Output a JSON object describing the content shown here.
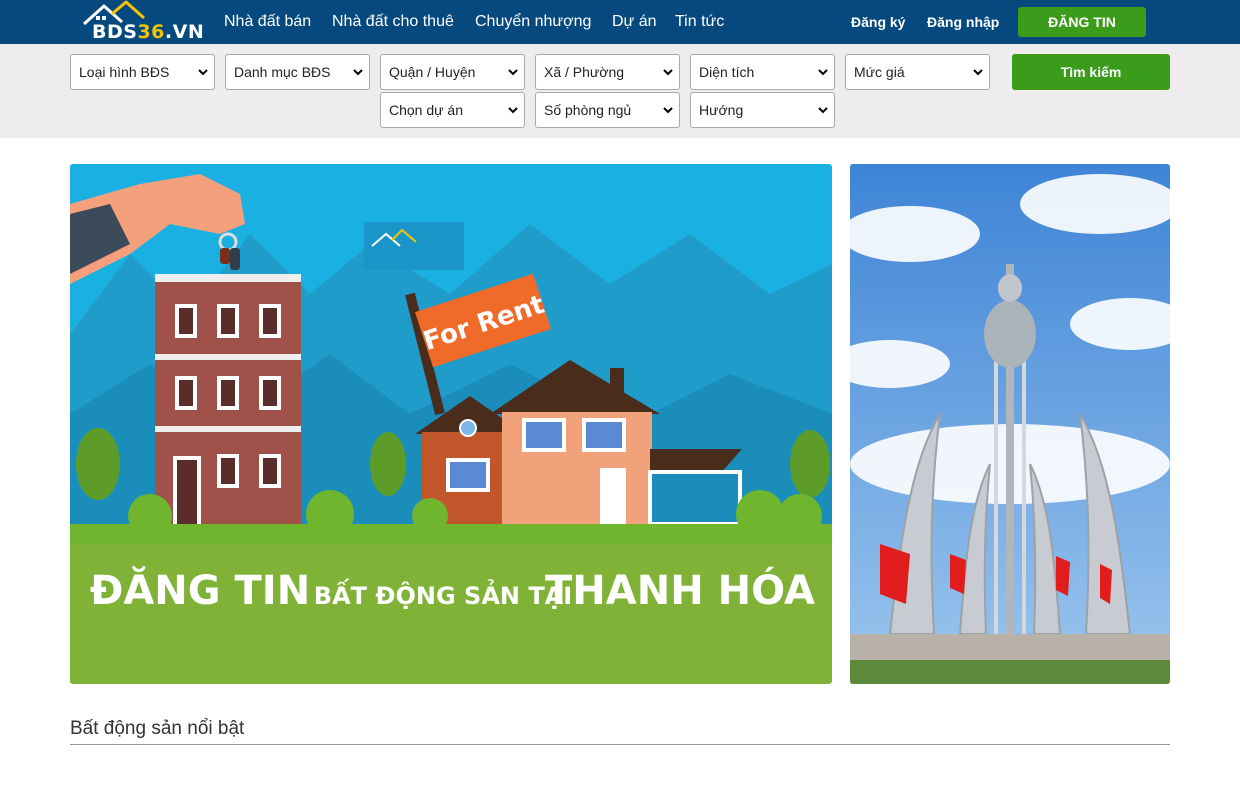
{
  "brand": {
    "logo_text_main": "BDS",
    "logo_text_highlight": "36",
    "logo_text_suffix": ".VN",
    "primary_color": "#05497f",
    "accent_color": "#3b9c1c",
    "logo_accent": "#f5c300"
  },
  "nav": {
    "items": [
      {
        "label": "Nhà đất bán"
      },
      {
        "label": "Nhà đất cho thuê"
      },
      {
        "label": "Chuyển nhượng"
      },
      {
        "label": "Dự án"
      },
      {
        "label": "Tin tức"
      }
    ],
    "register_label": "Đăng ký",
    "login_label": "Đăng nhập",
    "post_label": "ĐĂNG TIN"
  },
  "search": {
    "filters_row1": [
      {
        "label": "Loại hình BĐS"
      },
      {
        "label": "Danh mục BĐS"
      },
      {
        "label": "Quận / Huyện"
      },
      {
        "label": "Xã / Phường"
      },
      {
        "label": "Diện tích"
      },
      {
        "label": "Mức giá"
      }
    ],
    "filters_row2": [
      {
        "label": "Chọn dự án"
      },
      {
        "label": "Số phòng ngủ"
      },
      {
        "label": "Hướng"
      }
    ],
    "submit_label": "Tìm kiếm"
  },
  "banner": {
    "sign_text": "For Rent",
    "headline_part1": "ĐĂNG TIN",
    "headline_part2": "BẤT ĐỘNG SẢN TẠI",
    "headline_part3": "THANH HÓA",
    "sky_color": "#1bb0e2",
    "band_color": "#7fb236"
  },
  "featured": {
    "title": "Bất động sản nổi bật"
  }
}
